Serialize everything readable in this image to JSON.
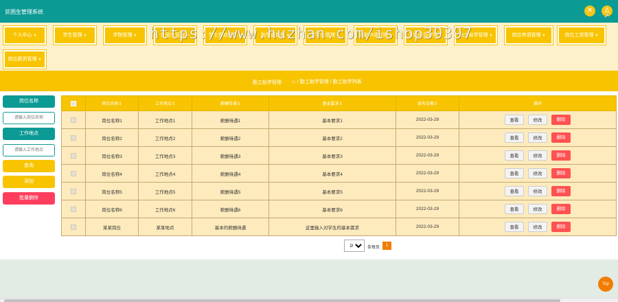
{
  "header": {
    "app_title": "贫困生管理系统",
    "close_glyph": "✕",
    "user_glyph": "♙"
  },
  "watermark": "https://www.huzhan.com/ishop39397",
  "menu": [
    {
      "label": "个人中心"
    },
    {
      "label": "学生管理"
    },
    {
      "label": "学院管理"
    },
    {
      "label": "贫困生管理"
    },
    {
      "label": "学生资助管理"
    },
    {
      "label": "助学金管理"
    },
    {
      "label": "奖学金管理"
    },
    {
      "label": "资助申请管理"
    },
    {
      "label": "资助项目管理"
    },
    {
      "label": "勤工助学管理"
    },
    {
      "label": "岗位申请管理"
    },
    {
      "label": "岗位工资管理"
    },
    {
      "label": "岗位薪资管理"
    }
  ],
  "breadcrumb": {
    "heading": "勤工助学管理",
    "path": "/ 勤工助学管理 / 勤工助学列表",
    "home_glyph": "⌂"
  },
  "sidebar": {
    "post_name_label": "岗位名称",
    "post_name_placeholder": "请输入岗位名称",
    "location_label": "工作地点",
    "location_placeholder": "请输入工作地点",
    "search_label": "查询",
    "add_label": "添加",
    "batch_delete_label": "批量删除"
  },
  "table": {
    "headers": [
      "岗位名称⇕",
      "工作地点⇕",
      "薪酬待遇⇕",
      "基本要求⇕",
      "发布日期⇕",
      "操作"
    ],
    "action_labels": {
      "view": "查看",
      "edit": "修改",
      "delete": "删除"
    },
    "rows": [
      {
        "name": "岗位名称1",
        "location": "工作地点1",
        "salary": "薪酬待遇1",
        "requirement": "基本要求1",
        "date": "2022-03-29"
      },
      {
        "name": "岗位名称2",
        "location": "工作地点2",
        "salary": "薪酬待遇2",
        "requirement": "基本要求2",
        "date": "2022-03-29"
      },
      {
        "name": "岗位名称3",
        "location": "工作地点3",
        "salary": "薪酬待遇3",
        "requirement": "基本要求3",
        "date": "2022-03-29"
      },
      {
        "name": "岗位名称4",
        "location": "工作地点4",
        "salary": "薪酬待遇4",
        "requirement": "基本要求4",
        "date": "2022-03-29"
      },
      {
        "name": "岗位名称5",
        "location": "工作地点5",
        "salary": "薪酬待遇5",
        "requirement": "基本要求5",
        "date": "2022-03-29"
      },
      {
        "name": "岗位名称6",
        "location": "工作地点6",
        "salary": "薪酬待遇6",
        "requirement": "基本要求6",
        "date": "2022-03-29"
      },
      {
        "name": "某某岗位",
        "location": "某某地点",
        "salary": "基本的薪酬待遇",
        "requirement": "这里输入对学生的基本需求",
        "date": "2022-03-29"
      }
    ]
  },
  "pager": {
    "page_size": "10",
    "per_page_label": "条每页",
    "current_page": "1"
  },
  "top_label": "Top",
  "colors": {
    "primary": "#0c9a94",
    "accent": "#f8c400",
    "danger": "#ff3e5d",
    "orange": "#f07d00"
  }
}
